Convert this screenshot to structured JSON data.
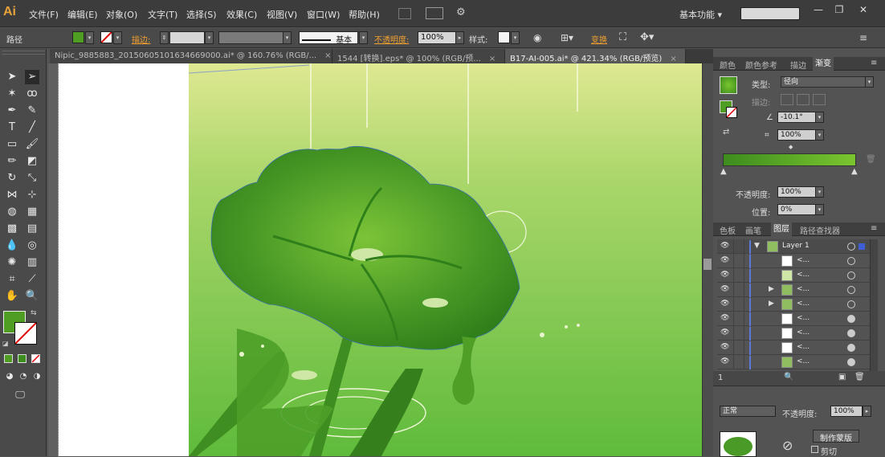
{
  "app": {
    "logo": "Ai"
  },
  "menu": [
    "文件(F)",
    "编辑(E)",
    "对象(O)",
    "文字(T)",
    "选择(S)",
    "效果(C)",
    "视图(V)",
    "窗口(W)",
    "帮助(H)"
  ],
  "workspace_label": "基本功能",
  "control_bar": {
    "selection_label": "路径",
    "stroke_label": "描边:",
    "brush_label": "基本",
    "opacity_label": "不透明度:",
    "opacity_value": "100%",
    "style_label": "样式:",
    "transform_label": "变换"
  },
  "tabs": [
    {
      "label": "Nipic_9885883_20150605101634669000.ai* @ 160.76% (RGB/...",
      "active": false
    },
    {
      "label": "1544 [转换].eps* @ 100% (RGB/预...",
      "active": false
    },
    {
      "label": "B17-AI-005.ai* @ 421.34% (RGB/预览)",
      "active": true
    }
  ],
  "colors": {
    "fill": "#4f9e23",
    "gradient_start": "#3d8c1e",
    "gradient_end": "#7ac52f",
    "sky_top": "#d6e58a",
    "sky_bottom": "#5db83a",
    "leaf": "#4a9a27",
    "accent": "#f1a02f"
  },
  "right_panel": {
    "top_tabs": [
      "颜色",
      "颜色参考",
      "描边",
      "渐变"
    ],
    "gradient": {
      "type_label": "类型:",
      "type_value": "径向",
      "stroke_label": "描边:",
      "angle_value": "-10.1°",
      "aspect_value": "100%",
      "opacity_label": "不透明度:",
      "opacity_value": "100%",
      "location_label": "位置:",
      "location_value": "0%"
    },
    "bottom_tabs": [
      "色板",
      "画笔",
      "图层",
      "路径查找器"
    ],
    "layers": {
      "top_layer_name": "Layer 1",
      "sublayer_names": [
        "<...",
        "<...",
        "<...",
        "<...",
        "<...",
        "<...",
        "<...",
        "<..."
      ],
      "count_label": "1"
    },
    "transparency": {
      "mode_label": "正常",
      "opacity_label": "不透明度:",
      "opacity_value": "100%",
      "make_mask_label": "制作蒙版",
      "clip_label": "剪切"
    }
  },
  "icons": {
    "selection": "selection-arrow-icon",
    "direct_selection": "direct-selection-icon"
  }
}
